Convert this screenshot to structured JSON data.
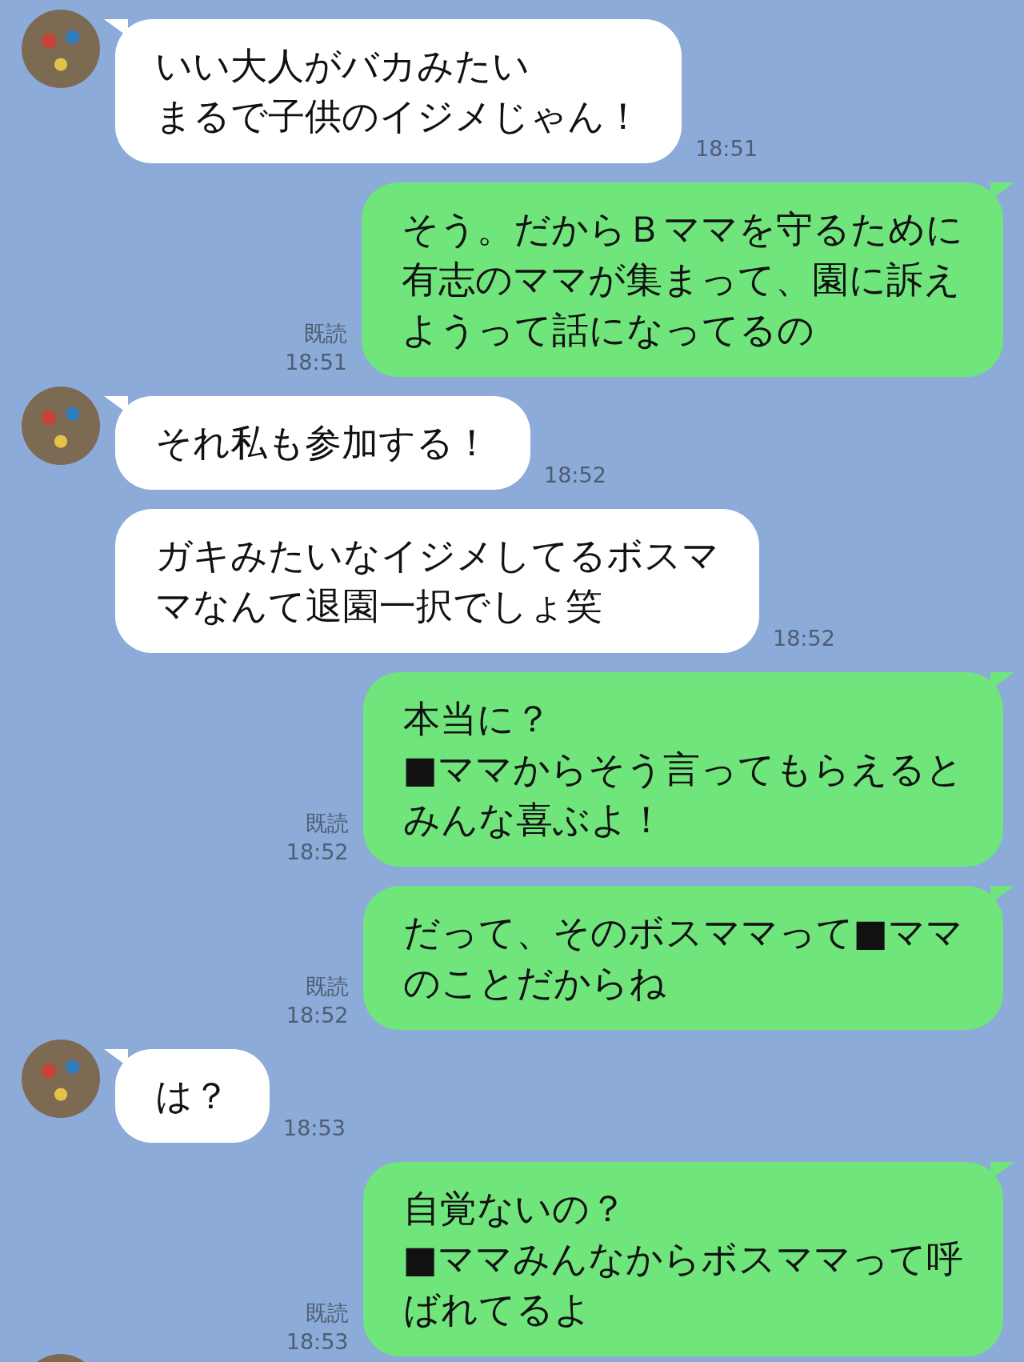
{
  "messages": [
    {
      "kind": "received",
      "show_avatar": true,
      "lines": [
        "いい大人がバカみたい",
        "まるで子供のイジメじゃん！"
      ],
      "time": "18:51"
    },
    {
      "kind": "sent",
      "lines": [
        "そう。だからＢママを守るために",
        "有志のママが集まって、園に訴え",
        "ようって話になってるの"
      ],
      "read_label": "既読",
      "time": "18:51"
    },
    {
      "kind": "received",
      "show_avatar": true,
      "lines": [
        "それ私も参加する！"
      ],
      "time": "18:52"
    },
    {
      "kind": "received",
      "show_avatar": false,
      "lines": [
        "ガキみたいなイジメしてるボスマ",
        "マなんて退園一択でしょ笑"
      ],
      "time": "18:52"
    },
    {
      "kind": "sent",
      "lines": [
        "本当に？",
        "■ママからそう言ってもらえると",
        "みんな喜ぶよ！"
      ],
      "read_label": "既読",
      "time": "18:52"
    },
    {
      "kind": "sent",
      "lines": [
        "だって、そのボスママって■ママ",
        "のことだからね"
      ],
      "read_label": "既読",
      "time": "18:52"
    },
    {
      "kind": "received",
      "show_avatar": true,
      "lines": [
        "は？"
      ],
      "time": "18:53"
    },
    {
      "kind": "sent",
      "lines": [
        "自覚ないの？",
        "■ママみんなからボスママって呼",
        "ばれてるよ"
      ],
      "read_label": "既読",
      "time": "18:53"
    }
  ]
}
